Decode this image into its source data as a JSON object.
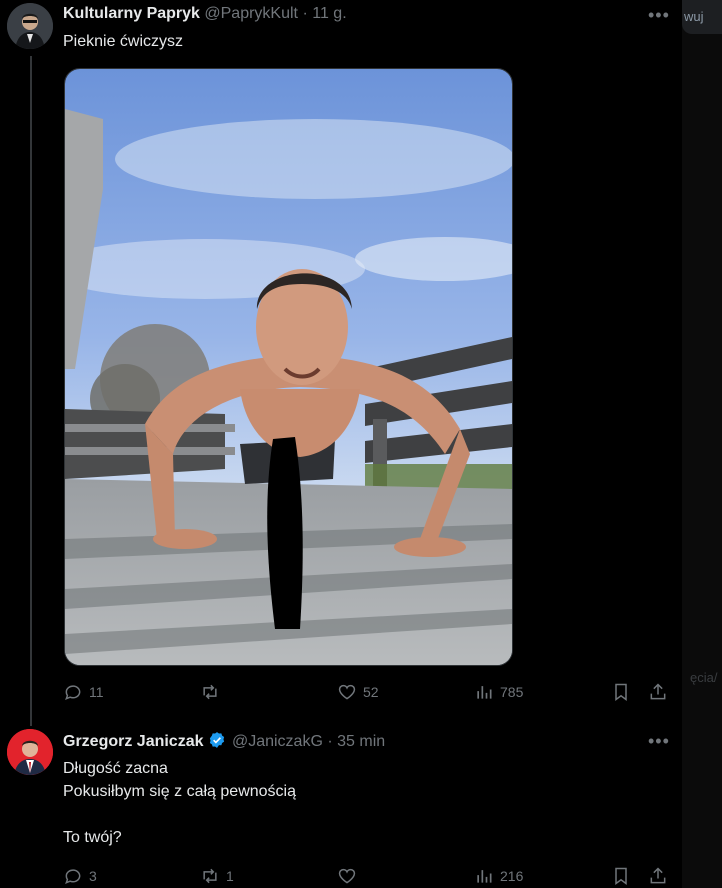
{
  "tweet1": {
    "author_name": "Kultularny Papryk",
    "handle": "@PaprykKult",
    "separator": "·",
    "time": "11 g.",
    "text": "Pieknie ćwiczysz",
    "stats": {
      "replies": "11",
      "reposts": "",
      "likes": "52",
      "views": "785"
    }
  },
  "tweet2": {
    "author_name": "Grzegorz Janiczak",
    "handle": "@JaniczakG",
    "separator": "·",
    "time": "35 min",
    "text": "Długość zacna\nPokusiłbym się z całą pewnością\n\nTo twój?",
    "stats": {
      "replies": "3",
      "reposts": "1",
      "likes": "",
      "views": "216"
    }
  },
  "sidebar_peek": {
    "button_text": "wuj",
    "ghost_text": "ęcia/"
  },
  "colors": {
    "background": "#000000",
    "text": "#e7e9ea",
    "muted": "#71767b",
    "verified": "#1d9bf0",
    "divider": "#333639"
  },
  "icons": {
    "reply": "speech-bubble",
    "repost": "two-arrows-loop",
    "like": "heart",
    "views": "bar-chart",
    "bookmark": "bookmark",
    "share": "upload-arrow",
    "more": "three-dots"
  }
}
